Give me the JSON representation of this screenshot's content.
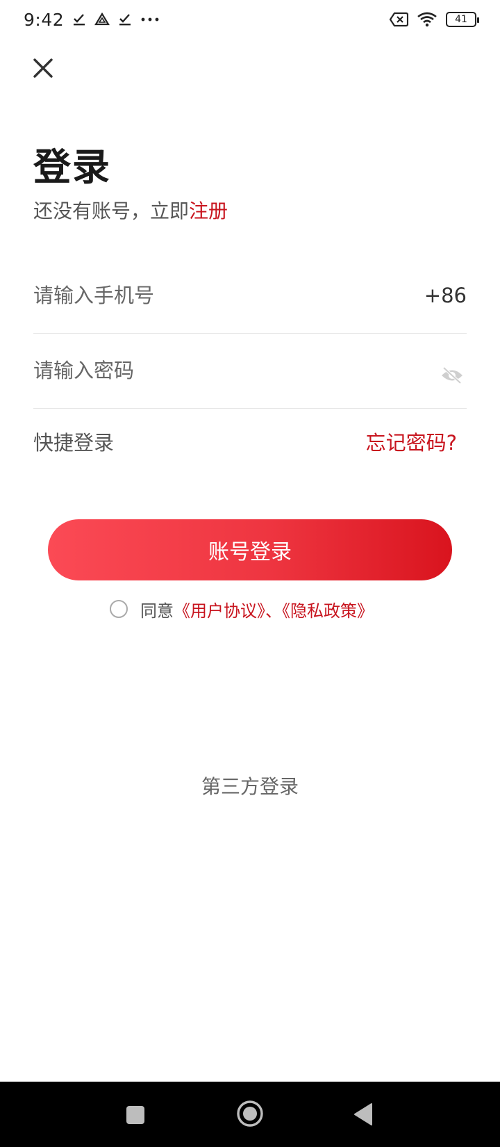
{
  "status_bar": {
    "time": "9:42",
    "icons": [
      "check-download-icon",
      "drive-icon",
      "check-download-icon",
      "more-dots-icon"
    ],
    "right_icons": [
      "no-sim-icon",
      "wifi-icon",
      "battery-icon"
    ],
    "battery_level": "41"
  },
  "header": {
    "close_icon": "close-icon"
  },
  "title": "登录",
  "register": {
    "prompt": "还没有账号，立即",
    "link": "注册"
  },
  "form": {
    "phone_placeholder": "请输入手机号",
    "phone_value": "",
    "country_code": "+86",
    "password_placeholder": "请输入密码",
    "password_value": "",
    "password_toggle_icon": "eye-off-icon",
    "quick_login": "快捷登录",
    "forgot_password": "忘记密码?"
  },
  "login_button": "账号登录",
  "agreement": {
    "prefix": "同意",
    "links": "《用户协议》、《隐私政策》"
  },
  "third_party_label": "第三方登录",
  "nav_bar": {
    "icons": [
      "recent-apps-icon",
      "home-icon",
      "back-icon"
    ]
  },
  "colors": {
    "accent": "#c8141e",
    "button_start": "#fb4a55",
    "button_end": "#d9141e"
  }
}
